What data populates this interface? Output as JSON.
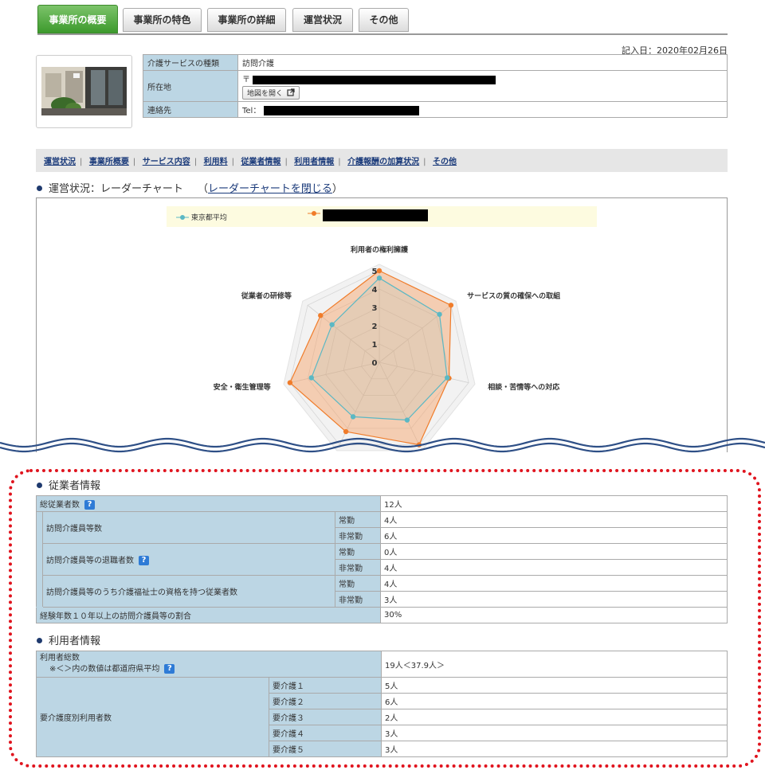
{
  "tabs": [
    {
      "label": "事業所の概要",
      "active": true
    },
    {
      "label": "事業所の特色",
      "active": false
    },
    {
      "label": "事業所の詳細",
      "active": false
    },
    {
      "label": "運営状況",
      "active": false
    },
    {
      "label": "その他",
      "active": false
    }
  ],
  "record_date": "記入日：2020年02月26日",
  "overview": {
    "service_type_label": "介護サービスの種類",
    "service_type_value": "訪問介護",
    "address_label": "所在地",
    "address_prefix": "〒",
    "map_button": "地図を開く",
    "contact_label": "連絡先",
    "contact_prefix": "Tel："
  },
  "subnav": [
    "運営状況",
    "事業所概要",
    "サービス内容",
    "利用料",
    "従業者情報",
    "利用者情報",
    "介護報酬の加算状況",
    "その他"
  ],
  "radar_section": {
    "heading": "運営状況：レーダーチャート",
    "close_open": "（",
    "close_link": "レーダーチャートを閉じる",
    "close_close": "）"
  },
  "chart_data": {
    "type": "radar",
    "axes": [
      "利用者の権利擁護",
      "サービスの質の確保への取組",
      "相談・苦情等への対応",
      "",
      "",
      "安全・衛生管理等",
      "従業者の研修等"
    ],
    "ticks": [
      "0",
      "1",
      "2",
      "3",
      "4",
      "5"
    ],
    "rlim": [
      0,
      5
    ],
    "series": [
      {
        "name": "東京都平均",
        "color": "#5bb8c4",
        "values": [
          4.6,
          4.2,
          3.8,
          3.5,
          3.3,
          3.8,
          3.3
        ]
      },
      {
        "name": "",
        "color": "#f07c2a",
        "values": [
          5.0,
          5.0,
          3.9,
          5.0,
          4.2,
          5.0,
          4.1
        ]
      }
    ]
  },
  "staff_section": {
    "heading": "従業者情報",
    "rows": [
      {
        "label": "総従業者数",
        "value": "12人"
      },
      {
        "label": "訪問介護員等数",
        "sub1": "常勤",
        "value1": "4人",
        "sub2": "非常勤",
        "value2": "6人"
      },
      {
        "label": "訪問介護員等の退職者数",
        "sub1": "常勤",
        "value1": "0人",
        "sub2": "非常勤",
        "value2": "4人"
      },
      {
        "label": "訪問介護員等のうち介護福祉士の資格を持つ従業者数",
        "sub1": "常勤",
        "value1": "4人",
        "sub2": "非常勤",
        "value2": "3人"
      },
      {
        "label": "経験年数１０年以上の訪問介護員等の割合",
        "value": "30%"
      }
    ]
  },
  "user_section": {
    "heading": "利用者情報",
    "total_label": "利用者総数",
    "total_note": "※＜＞内の数値は都道府県平均",
    "total_value": "19人＜37.9人＞",
    "level_label": "要介護度別利用者数",
    "levels": [
      {
        "label": "要介護１",
        "value": "5人"
      },
      {
        "label": "要介護２",
        "value": "6人"
      },
      {
        "label": "要介護３",
        "value": "2人"
      },
      {
        "label": "要介護４",
        "value": "3人"
      },
      {
        "label": "要介護５",
        "value": "3人"
      }
    ]
  },
  "help_glyph": "?",
  "colors": {
    "tab_active": "#4aa63a",
    "header_bg": "#bcd6e4",
    "link": "#1a3a7a",
    "frame": "#e0141e",
    "wave": "#2e4f86"
  }
}
